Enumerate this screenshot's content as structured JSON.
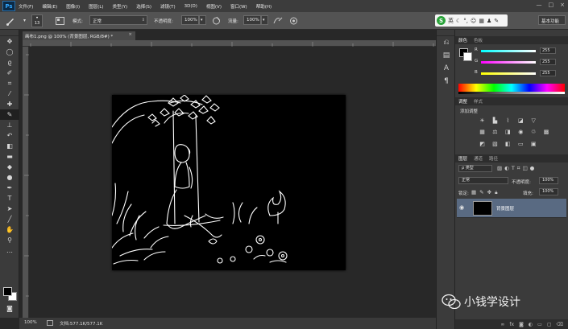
{
  "app": {
    "logo": "Ps",
    "menus": [
      "文件(F)",
      "编辑(E)",
      "图像(I)",
      "图层(L)",
      "类型(Y)",
      "选择(S)",
      "滤镜(T)",
      "3D(D)",
      "视图(V)",
      "窗口(W)",
      "帮助(H)"
    ],
    "window_controls": [
      "—",
      "□",
      "×"
    ]
  },
  "options_bar": {
    "brush_size": "13",
    "mode_label": "模式:",
    "mode_value": "正常",
    "opacity_label": "不透明度:",
    "opacity_value": "100%",
    "flow_label": "流量:",
    "flow_value": "100%",
    "ime_label": "英",
    "workspace": "基本功能"
  },
  "tools": [
    "move-icon",
    "marquee-icon",
    "lasso-icon",
    "quick-select-icon",
    "crop-icon",
    "eyedropper-icon",
    "healing-icon",
    "brush-icon",
    "stamp-icon",
    "history-brush-icon",
    "eraser-icon",
    "gradient-icon",
    "blur-icon",
    "dodge-icon",
    "pen-icon",
    "type-icon",
    "path-select-icon",
    "shape-icon",
    "hand-icon",
    "zoom-icon"
  ],
  "document": {
    "tab_title": "画布1.png @ 100% (背景图层, RGB/8#) *",
    "close": "×"
  },
  "status": {
    "zoom": "100%",
    "doc_info": "文档:577.1K/577.1K"
  },
  "color_panel": {
    "tabs": [
      "颜色",
      "色板"
    ],
    "rows": [
      {
        "label": "R",
        "value": "255",
        "gradient": [
          "#00ffff",
          "#ffffff"
        ]
      },
      {
        "label": "G",
        "value": "255",
        "gradient": [
          "#ff00ff",
          "#ffffff"
        ]
      },
      {
        "label": "B",
        "value": "255",
        "gradient": [
          "#ffff00",
          "#ffffff"
        ]
      }
    ]
  },
  "adjustments_panel": {
    "tabs": [
      "调整",
      "样式"
    ],
    "title": "添加调整"
  },
  "layers_panel": {
    "tabs": [
      "图层",
      "通道",
      "路径"
    ],
    "kind_label": "ρ 类型",
    "blend_mode": "正常",
    "opacity_label": "不透明度:",
    "opacity_value": "100%",
    "lock_label": "锁定:",
    "fill_label": "填充:",
    "fill_value": "100%",
    "layers": [
      {
        "name": "背景图层",
        "visible": true
      }
    ]
  },
  "watermark": {
    "text": "小钱学设计"
  }
}
